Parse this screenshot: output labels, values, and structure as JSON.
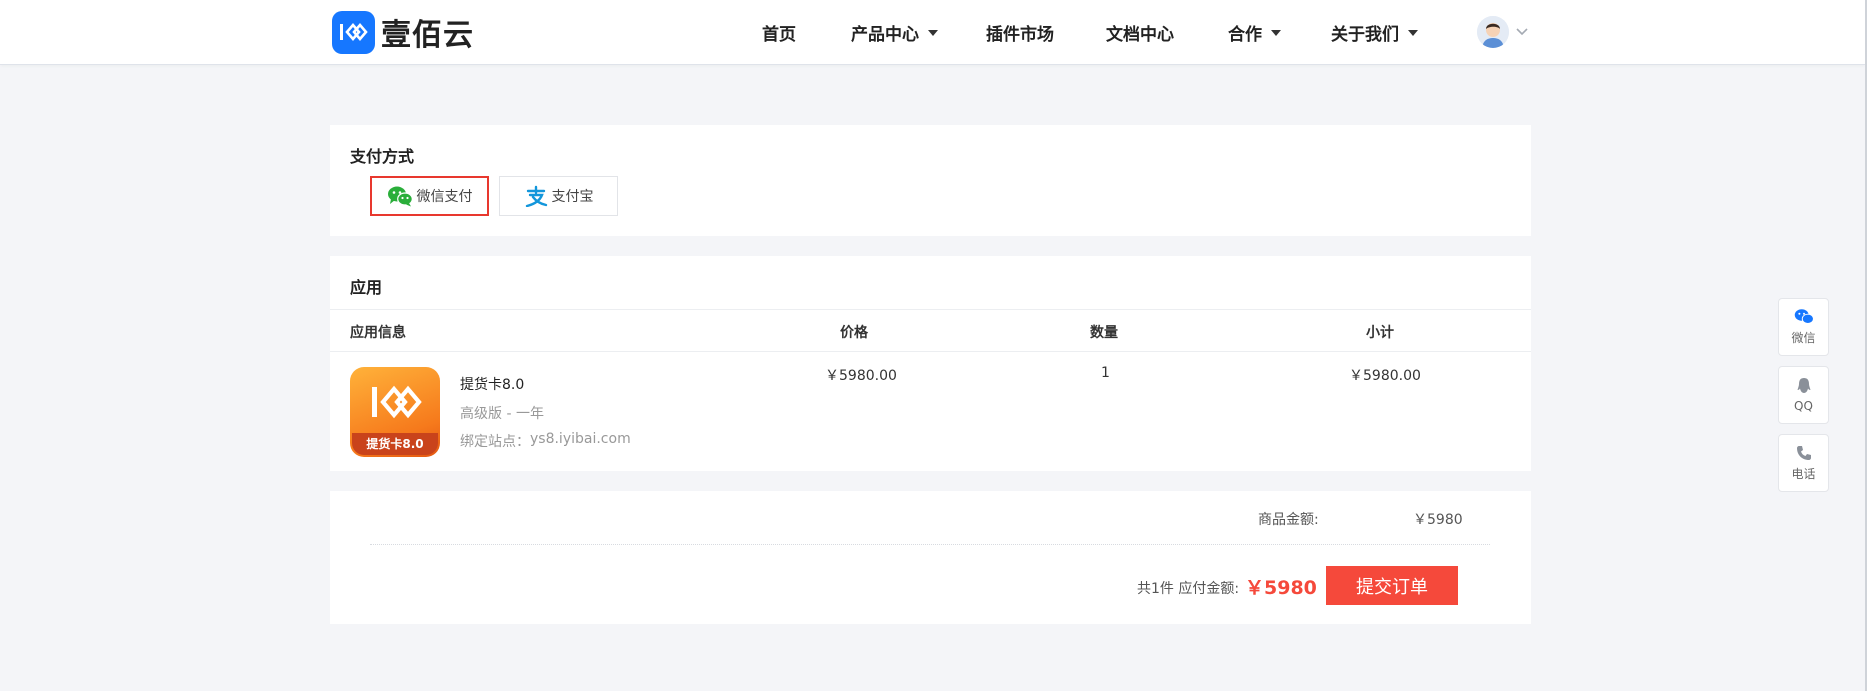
{
  "header": {
    "logo_text": "壹佰云",
    "nav": [
      {
        "label": "首页"
      },
      {
        "label": "产品中心"
      },
      {
        "label": "插件市场"
      },
      {
        "label": "文档中心"
      },
      {
        "label": "合作"
      },
      {
        "label": "关于我们"
      }
    ]
  },
  "payment": {
    "title": "支付方式",
    "options": [
      {
        "label": "微信支付",
        "selected": true
      },
      {
        "label": "支付宝",
        "selected": false
      }
    ]
  },
  "app": {
    "title": "应用",
    "columns": [
      "应用信息",
      "价格",
      "数量",
      "小计"
    ],
    "item": {
      "icon_badge": "提货卡8.0",
      "name": "提货卡8.0",
      "edition": "高级版 - 一年",
      "site_label": "绑定站点：",
      "site": "ys8.iyibai.com",
      "price": "￥5980.00",
      "quantity": "1",
      "subtotal": "￥5980.00"
    }
  },
  "summary": {
    "goods_label": "商品金额:",
    "goods_amount": "￥5980",
    "count_text": "共1件 应付金额:",
    "payable": "￥5980",
    "submit_label": "提交订单"
  },
  "float": [
    {
      "label": "微信"
    },
    {
      "label": "QQ"
    },
    {
      "label": "电话"
    }
  ],
  "colors": {
    "brand": "#1677ff",
    "accent_red": "#f5493b",
    "wechat_green": "#2aae3a",
    "alipay_blue": "#1296db"
  }
}
